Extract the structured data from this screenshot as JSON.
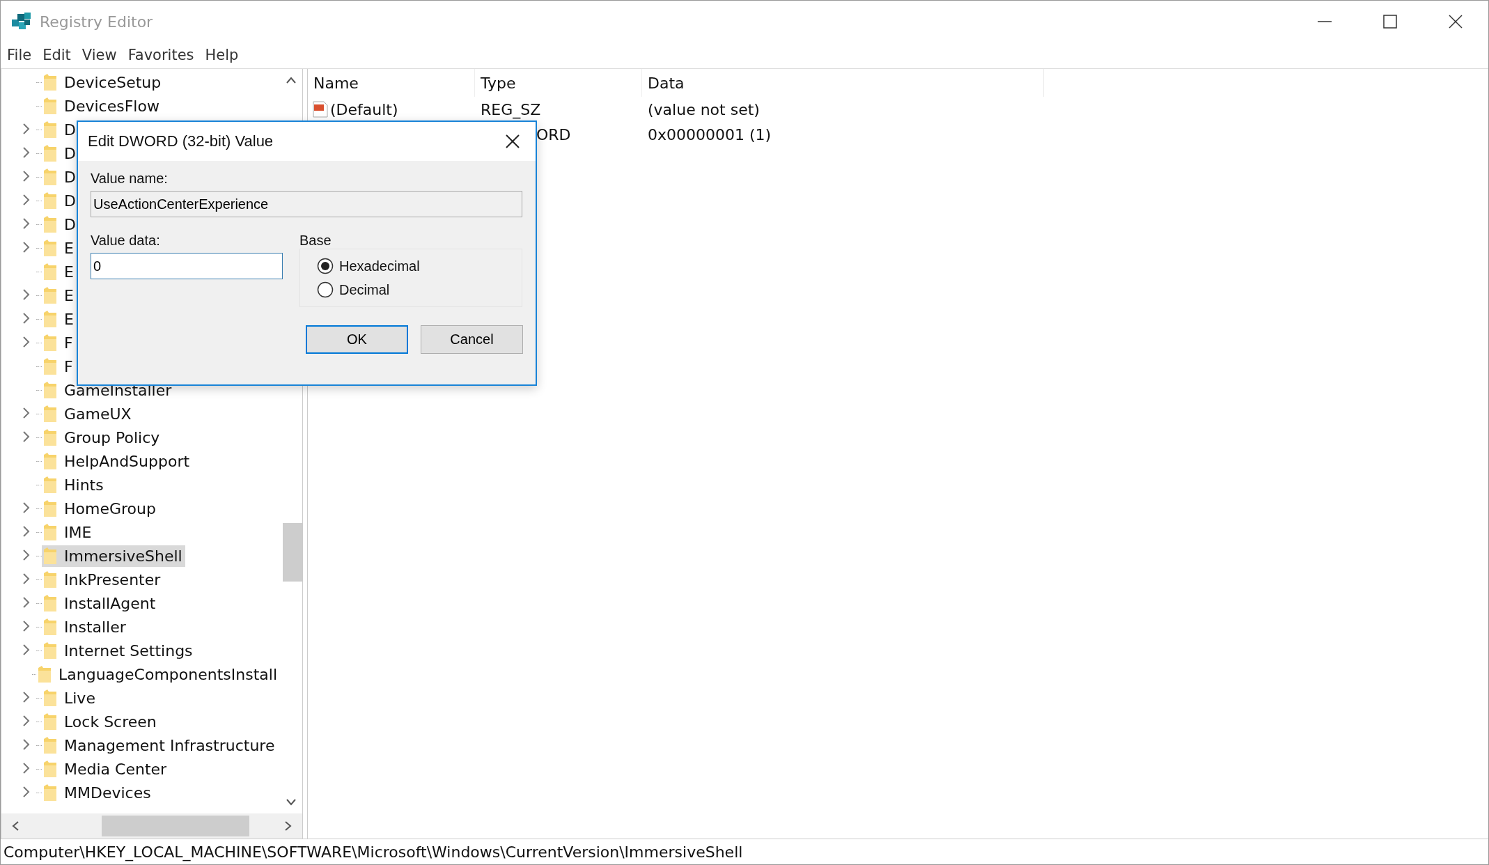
{
  "window": {
    "title": "Registry Editor"
  },
  "menu": [
    "File",
    "Edit",
    "View",
    "Favorites",
    "Help"
  ],
  "tree": [
    {
      "label": "DeviceSetup",
      "expandable": false,
      "selected": false
    },
    {
      "label": "DevicesFlow",
      "expandable": false,
      "selected": false
    },
    {
      "label": "D",
      "expandable": true,
      "selected": false
    },
    {
      "label": "D",
      "expandable": true,
      "selected": false
    },
    {
      "label": "D",
      "expandable": true,
      "selected": false
    },
    {
      "label": "D",
      "expandable": true,
      "selected": false
    },
    {
      "label": "D",
      "expandable": true,
      "selected": false
    },
    {
      "label": "E",
      "expandable": true,
      "selected": false
    },
    {
      "label": "E",
      "expandable": false,
      "selected": false
    },
    {
      "label": "E",
      "expandable": true,
      "selected": false
    },
    {
      "label": "E",
      "expandable": true,
      "selected": false
    },
    {
      "label": "F",
      "expandable": true,
      "selected": false
    },
    {
      "label": "F",
      "expandable": false,
      "selected": false
    },
    {
      "label": "GameInstaller",
      "expandable": false,
      "selected": false
    },
    {
      "label": "GameUX",
      "expandable": true,
      "selected": false
    },
    {
      "label": "Group Policy",
      "expandable": true,
      "selected": false
    },
    {
      "label": "HelpAndSupport",
      "expandable": false,
      "selected": false
    },
    {
      "label": "Hints",
      "expandable": false,
      "selected": false
    },
    {
      "label": "HomeGroup",
      "expandable": true,
      "selected": false
    },
    {
      "label": "IME",
      "expandable": true,
      "selected": false
    },
    {
      "label": "ImmersiveShell",
      "expandable": true,
      "selected": true
    },
    {
      "label": "InkPresenter",
      "expandable": true,
      "selected": false
    },
    {
      "label": "InstallAgent",
      "expandable": true,
      "selected": false
    },
    {
      "label": "Installer",
      "expandable": true,
      "selected": false
    },
    {
      "label": "Internet Settings",
      "expandable": true,
      "selected": false
    },
    {
      "label": "LanguageComponentsInstall",
      "expandable": false,
      "selected": false
    },
    {
      "label": "Live",
      "expandable": true,
      "selected": false
    },
    {
      "label": "Lock Screen",
      "expandable": true,
      "selected": false
    },
    {
      "label": "Management Infrastructure",
      "expandable": true,
      "selected": false
    },
    {
      "label": "Media Center",
      "expandable": true,
      "selected": false
    },
    {
      "label": "MMDevices",
      "expandable": true,
      "selected": false
    }
  ],
  "values": {
    "columns": [
      "Name",
      "Type",
      "Data"
    ],
    "rows": [
      {
        "name": "(Default)",
        "type": "REG_SZ",
        "data": "(value not set)"
      },
      {
        "type": "ORD",
        "data": "0x00000001 (1)"
      }
    ]
  },
  "status_bar": "Computer\\HKEY_LOCAL_MACHINE\\SOFTWARE\\Microsoft\\Windows\\CurrentVersion\\ImmersiveShell",
  "dialog": {
    "title": "Edit DWORD (32-bit) Value",
    "value_name_label": "Value name:",
    "value_name": "UseActionCenterExperience",
    "value_data_label": "Value data:",
    "value_data": "0",
    "base_label": "Base",
    "base_options": [
      {
        "label": "Hexadecimal",
        "selected": true
      },
      {
        "label": "Decimal",
        "selected": false
      }
    ],
    "buttons": [
      {
        "label": "OK",
        "default": true
      },
      {
        "label": "Cancel",
        "default": false
      }
    ]
  }
}
